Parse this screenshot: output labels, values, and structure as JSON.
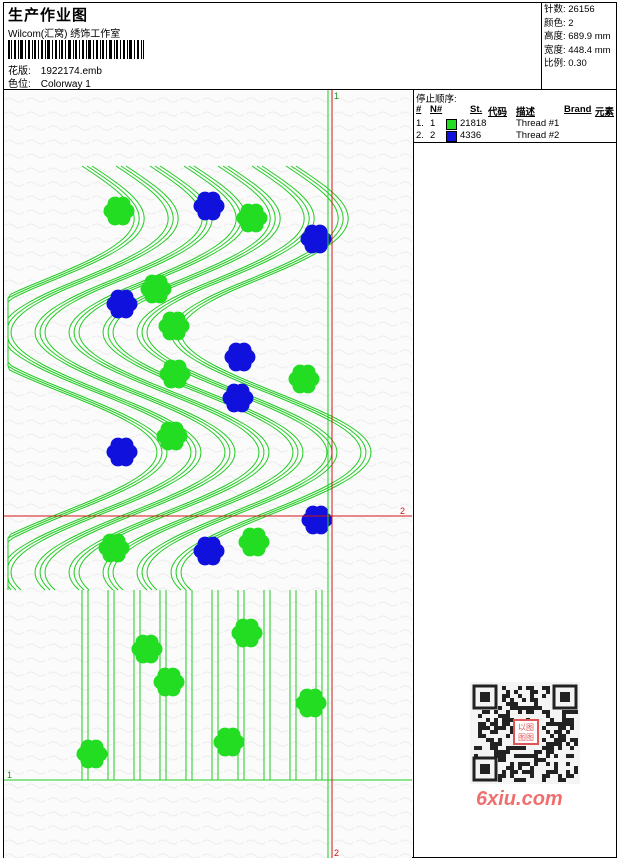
{
  "header": {
    "title": "生产作业图",
    "studio": "Wilcom(汇窝) 绣饰工作室",
    "design_label": "花版:",
    "design_file": "1922174.emb",
    "colorway_label": "色位:",
    "colorway": "Colorway 1"
  },
  "stats": {
    "stitches": "针数: 26156",
    "colors": "颜色: 2",
    "height": "高度: 689.9 mm",
    "width": "宽度: 448.4 mm",
    "scale": "比例: 0.30"
  },
  "stop_sequence": {
    "title": "停止顺序:",
    "columns": {
      "index": "#",
      "number": "N#",
      "st": "St.",
      "code": "代码",
      "description": "描述",
      "brand": "Brand",
      "element": "元素"
    },
    "rows": [
      {
        "index": "1.",
        "number": "1",
        "color": "#22dd22",
        "code": "21818",
        "description": "Thread #1"
      },
      {
        "index": "2.",
        "number": "2",
        "color": "#1111dd",
        "code": "4336",
        "description": "Thread #2"
      }
    ]
  },
  "canvas": {
    "guide_color": "#22cc22",
    "axis_color": "#cc1111",
    "markers": {
      "v_top": "1",
      "v_bottom": "2",
      "h_right": "2",
      "h_left": "1"
    }
  },
  "watermark": {
    "text": "6xiu.com",
    "badge": "以图\n图图"
  }
}
